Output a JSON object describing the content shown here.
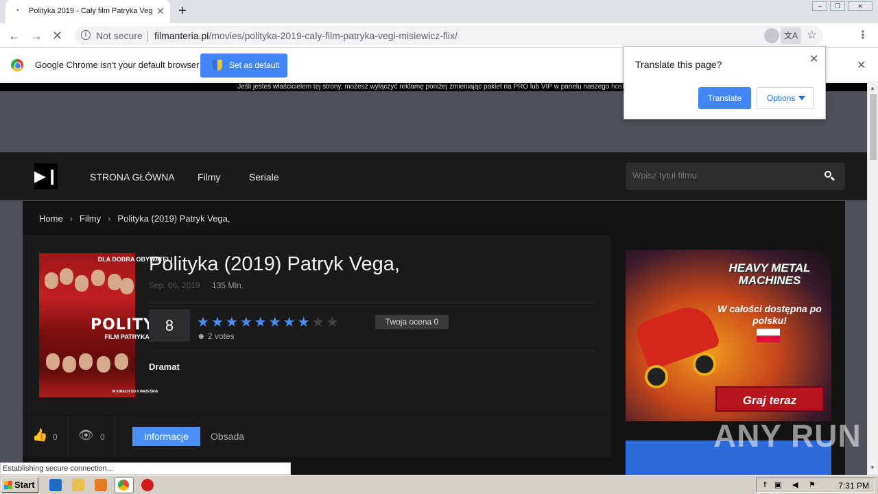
{
  "browser": {
    "tab_title": "Polityka 2019 - Cały film Patryka Veg",
    "tab_close": "✕",
    "new_tab": "+",
    "not_secure": "Not secure",
    "url_host": "filmanteria.pl",
    "url_path": "/movies/polityka-2019-caly-film-patryka-vegi-misiewicz-flix/"
  },
  "infobar": {
    "text": "Google Chrome isn't your default browser",
    "button": "Set as default",
    "close": "✕"
  },
  "translate": {
    "title": "Translate this page?",
    "translate_button": "Translate",
    "options_button": "Options",
    "close": "✕"
  },
  "page": {
    "ad_note": "Jeśli jesteś właścicielem tej strony, możesz wyłączyć reklamę poniżej zmieniając pakiet na PRO lub VIP w panelu naszego ",
    "ad_note_link": "hostin",
    "nav": [
      "STRONA GŁÓWNA",
      "Filmy",
      "Seriale"
    ],
    "search_placeholder": "Wpisz tytuł filmu",
    "breadcrumb": [
      "Home",
      "Filmy",
      "Polityka (2019) Patryk Vega,"
    ],
    "poster": {
      "top": "DLA DOBRA OBYWATELI",
      "title": "POLITYKA",
      "subtitle": "FILM PATRYKA VEGI",
      "bottom": "W KINACH OD 6 WRZEŚNIA"
    },
    "movie": {
      "title": "Polityka (2019) Patryk Vega,",
      "date": "Sep. 06, 2019",
      "duration": "135 Min.",
      "score": "8",
      "stars_filled": 8,
      "stars_total": 10,
      "votes": "2 votes",
      "user_rating": "Twoja ocena 0",
      "genre": "Dramat"
    },
    "actions": {
      "likes": "0",
      "views": "0",
      "tab_info": "informacje",
      "tab_cast": "Obsada"
    },
    "side_ad": {
      "brand": "HEAVY METAL MACHINES",
      "tagline": "W całości dostępna po polsku!",
      "cta": "Graj teraz"
    }
  },
  "status_text": "Establishing secure connection...",
  "watermark": "ANY RUN",
  "taskbar": {
    "start": "Start",
    "clock": "7:31 PM"
  }
}
